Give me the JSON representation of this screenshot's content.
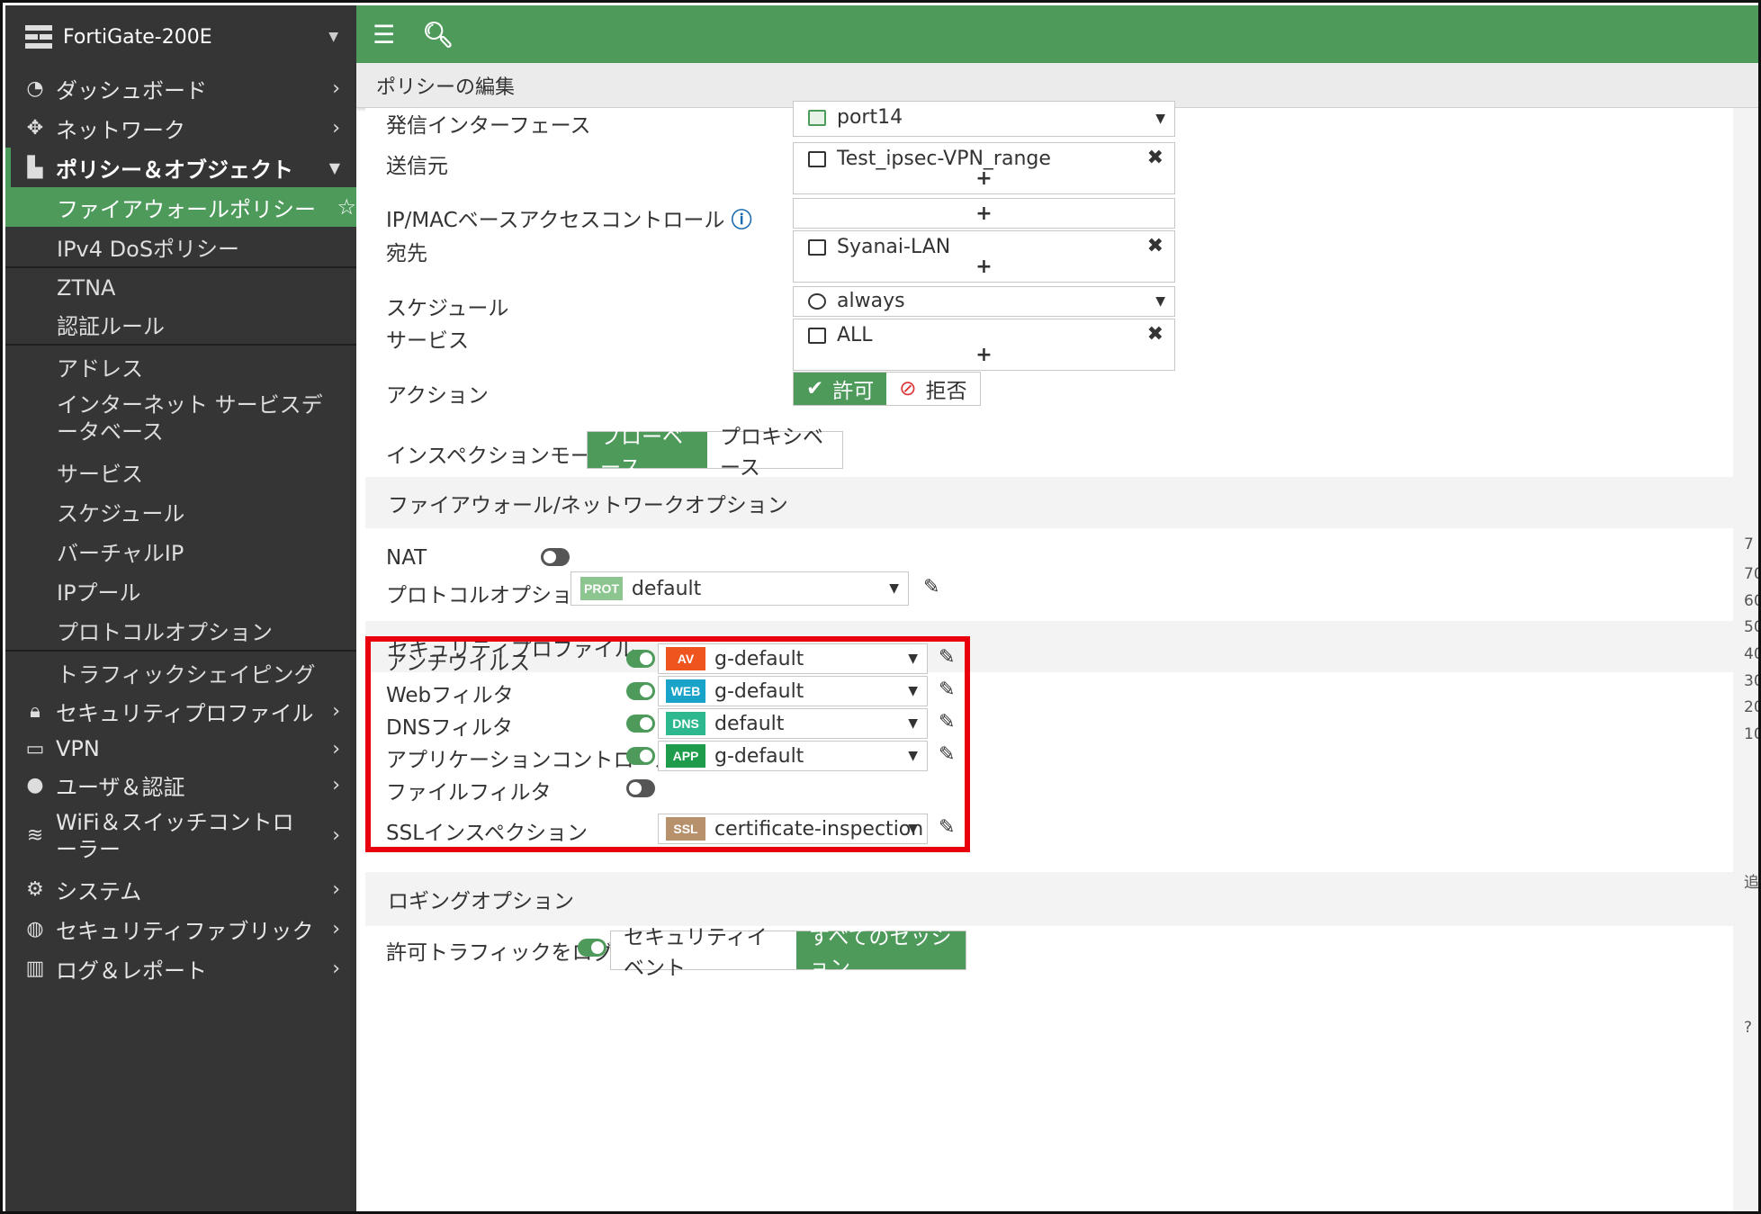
{
  "device": {
    "name": "FortiGate-200E"
  },
  "sidebar": {
    "items": [
      {
        "label": "ダッシュボード",
        "icon": "dashboard-icon"
      },
      {
        "label": "ネットワーク",
        "icon": "network-icon"
      },
      {
        "label": "ポリシー＆オブジェクト",
        "icon": "policy-icon"
      }
    ],
    "sub": {
      "firewall_policy": "ファイアウォールポリシー",
      "ipv4_dos": "IPv4 DoSポリシー",
      "ztna": "ZTNA",
      "auth_rules": "認証ルール",
      "address": "アドレス",
      "isdb": "インターネット サービスデ\nータベース",
      "services": "サービス",
      "schedule": "スケジュール",
      "vip": "バーチャルIP",
      "ippool": "IPプール",
      "protocol_options": "プロトコルオプション",
      "traffic_shaping": "トラフィックシェイピング"
    },
    "lower": [
      {
        "label": "セキュリティプロファイル",
        "icon": "lock-icon"
      },
      {
        "label": "VPN",
        "icon": "laptop-icon"
      },
      {
        "label": "ユーザ＆認証",
        "icon": "user-icon"
      },
      {
        "label": "WiFi＆スイッチコントロ\nーラー",
        "icon": "wifi-icon"
      },
      {
        "label": "システム",
        "icon": "gear-icon"
      },
      {
        "label": "セキュリティファブリック",
        "icon": "fabric-icon"
      },
      {
        "label": "ログ＆レポート",
        "icon": "chart-icon"
      }
    ]
  },
  "page": {
    "title": "ポリシーの編集"
  },
  "form": {
    "outgoing_label": "発信インターフェース",
    "outgoing_value": "port14",
    "source_label": "送信元",
    "source_value": "Test_ipsec-VPN_range",
    "ipmac_label": "IP/MACベースアクセスコントロール",
    "dest_label": "宛先",
    "dest_value": "Syanai-LAN",
    "schedule_label": "スケジュール",
    "schedule_value": "always",
    "service_label": "サービス",
    "service_value": "ALL",
    "action_label": "アクション",
    "action_accept": "許可",
    "action_deny": "拒否",
    "inspection_label": "インスペクションモード",
    "flow_based": "フローベース",
    "proxy_based": "プロキシベース"
  },
  "fw_options": {
    "section": "ファイアウォール/ネットワークオプション",
    "nat_label": "NAT",
    "nat_enabled": false,
    "protocol_label": "プロトコルオプション",
    "protocol_badge": "PROT",
    "protocol_value": "default"
  },
  "security_profiles": {
    "section": "セキュリティプロファイル",
    "rows": [
      {
        "label": "アンチウイルス",
        "enabled": true,
        "badge": "AV",
        "badge_color": "#f0541e",
        "value": "g-default"
      },
      {
        "label": "Webフィルタ",
        "enabled": true,
        "badge": "WEB",
        "badge_color": "#1aa3c9",
        "value": "g-default"
      },
      {
        "label": "DNSフィルタ",
        "enabled": true,
        "badge": "DNS",
        "badge_color": "#2db88f",
        "value": "default"
      },
      {
        "label": "アプリケーションコントロール",
        "enabled": true,
        "badge": "APP",
        "badge_color": "#1e9b4b",
        "value": "g-default"
      }
    ],
    "file_filter_label": "ファイルフィルタ",
    "file_filter_enabled": false,
    "ssl_label": "SSLインスペクション",
    "ssl_badge": "SSL",
    "ssl_badge_color": "#b6916c",
    "ssl_value": "certificate-inspection"
  },
  "logging": {
    "section": "ロギングオプション",
    "label": "許可トラフィックをログ",
    "enabled": true,
    "security_events": "セキュリティイベント",
    "all_sessions": "すべてのセッション"
  },
  "right_strip_ticks": [
    "7",
    "70",
    "60",
    "50",
    "40",
    "30",
    "20",
    "10",
    "追",
    "?"
  ],
  "colors": {
    "accent": "#4d9a5b",
    "sidebar": "#353535",
    "highlight": "#e8000d"
  }
}
